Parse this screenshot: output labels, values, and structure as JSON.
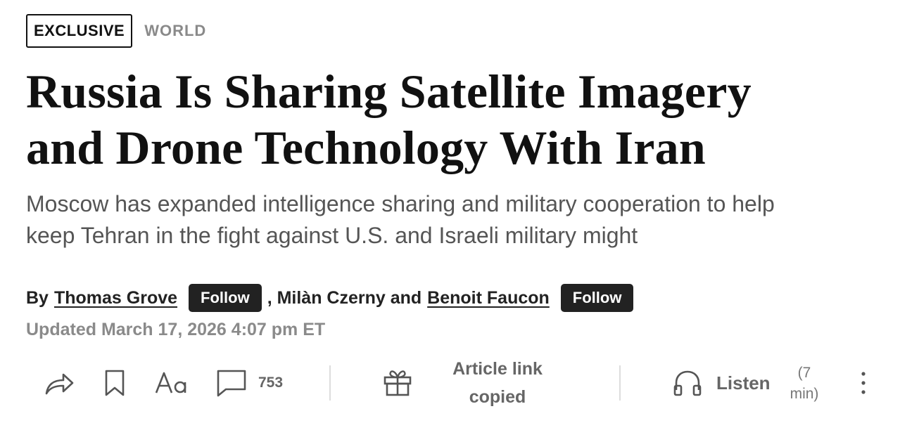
{
  "tags": {
    "exclusive": "EXCLUSIVE",
    "section": "WORLD"
  },
  "headline": {
    "line1": "Russia Is Sharing Satellite Imagery",
    "line2": "and Drone Technology With Iran"
  },
  "dek": {
    "line1": "Moscow has expanded intelligence sharing and military cooperation to help",
    "line2": "keep Tehran in the fight against U.S. and Israeli military might"
  },
  "byline": {
    "by": "By",
    "author1": "Thomas Grove",
    "follow1": "Follow",
    "middle": ", Milàn Czerny and",
    "author3": "Benoit Faucon",
    "follow2": "Follow"
  },
  "updated": "Updated March 17, 2026 4:07 pm ET",
  "toolbar": {
    "share_icon": "share-icon",
    "bookmark_icon": "bookmark-icon",
    "text_size_icon": "text-size-icon",
    "comment_icon": "comment-icon",
    "comment_count": "753",
    "gift_icon": "gift-icon",
    "copied_line1": "Article link",
    "copied_line2": "copied",
    "headphones_icon": "headphones-icon",
    "listen_label": "Listen",
    "duration_line1": "(7",
    "duration_line2": "min)",
    "more_icon": "more-vertical-icon"
  }
}
